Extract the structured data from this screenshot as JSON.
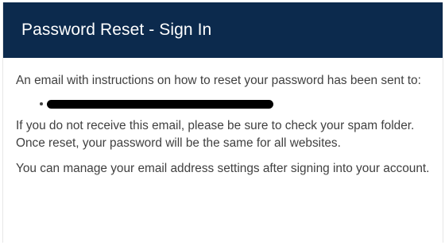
{
  "header": {
    "title": "Password Reset - Sign In"
  },
  "content": {
    "intro_text": "An email with instructions on how to reset your password has been sent to:",
    "email_list": [
      {
        "value": ""
      }
    ],
    "spam_note": "If you do not receive this email, please be sure to check your spam folder. Once reset, your password will be the same for all websites.",
    "manage_note": "You can manage your email address settings after signing into your account."
  },
  "colors": {
    "header_background": "#0c2a4d",
    "header_text": "#ffffff",
    "body_text": "#404040",
    "redaction": "#000000"
  }
}
